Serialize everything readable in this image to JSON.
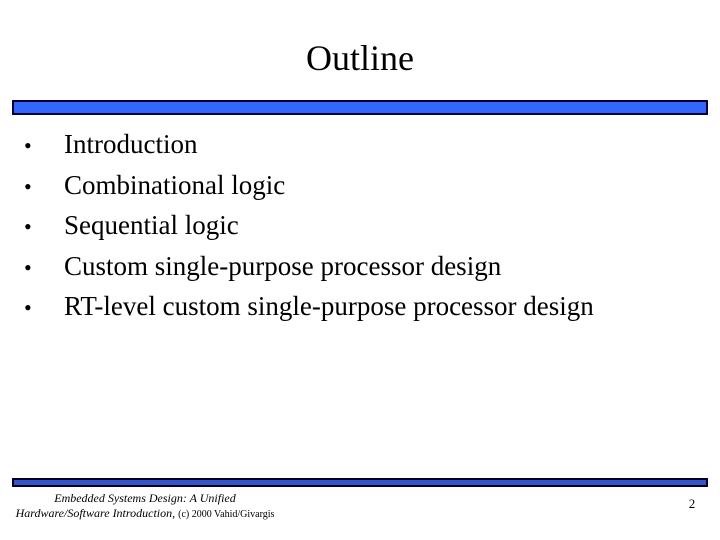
{
  "slide": {
    "title": "Outline",
    "bullet_symbol": "•",
    "bullets": [
      "Introduction",
      "Combinational logic",
      "Sequential logic",
      "Custom single-purpose processor design",
      "RT-level custom single-purpose processor design"
    ],
    "page_number": "2"
  },
  "footer": {
    "line1": "Embedded Systems Design: A Unified",
    "line2_italic": "Hardware/Software Introduction,",
    "line2_rest": "(c) 2000 Vahid/Givargis"
  },
  "colors": {
    "bar_fill": "#3366ff",
    "bar_border": "#000033"
  }
}
